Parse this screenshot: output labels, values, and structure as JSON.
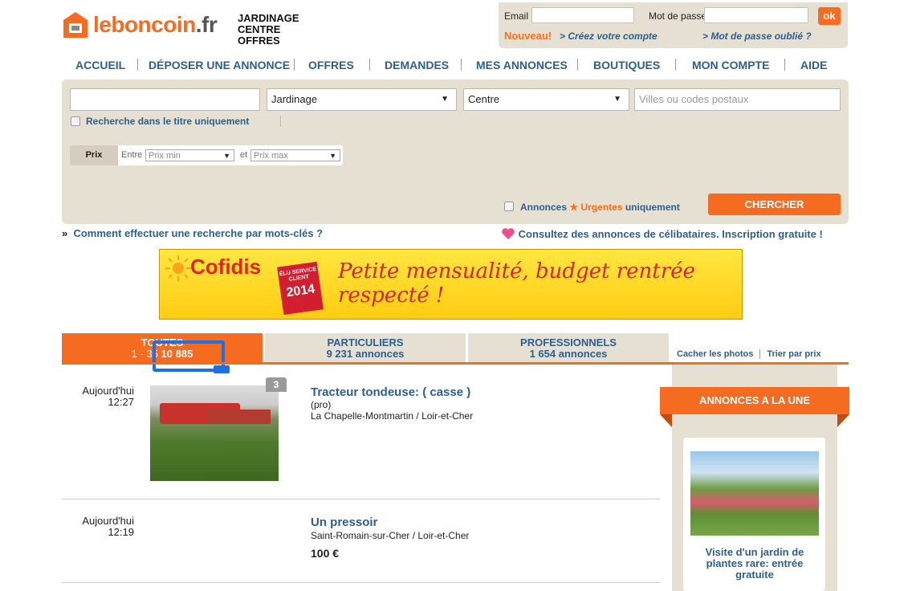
{
  "header": {
    "logo_text": "leboncoin",
    "logo_tld": ".fr",
    "crumbs": [
      "JARDINAGE",
      "CENTRE",
      "OFFRES"
    ]
  },
  "login": {
    "email_label": "Email",
    "password_label": "Mot de passe",
    "ok_label": "ok",
    "nouveau": "Nouveau!",
    "create_account": "> Créez votre compte",
    "forgot_password": "> Mot de passe oublié ?"
  },
  "nav": [
    "ACCUEIL",
    "DÉPOSER UNE ANNONCE",
    "OFFRES",
    "DEMANDES",
    "MES ANNONCES",
    "BOUTIQUES",
    "MON COMPTE",
    "AIDE"
  ],
  "search": {
    "keyword_value": "",
    "category": "Jardinage",
    "region": "Centre",
    "location_placeholder": "Villes ou codes postaux",
    "title_only_label": "Recherche dans le titre uniquement",
    "price_label": "Prix",
    "entre": "Entre",
    "et": "et",
    "price_min": "Prix min",
    "price_max": "Prix max",
    "urgent_1": "Annonces",
    "urgent_star": "★",
    "urgent_2": "Urgentes",
    "urgent_3": "uniquement",
    "submit": "CHERCHER"
  },
  "help": {
    "chevron": "»",
    "text": "Comment effectuer une recherche par mots-clés ?",
    "celib": "Consultez des annonces de célibataires. Inscription gratuite !"
  },
  "banner": {
    "brand": "Cofidis",
    "badge_top": "ÉLU SERVICE CLIENT",
    "badge_year": "2014",
    "slogan": "Petite mensualité, budget rentrée respecté !"
  },
  "tabs": [
    {
      "title": "TOUTES",
      "sub_range": "1 - 35",
      "sub_count": "10 885"
    },
    {
      "title": "PARTICULIERS",
      "sub": "9 231 annonces"
    },
    {
      "title": "PROFESSIONNELS",
      "sub": "1 654 annonces"
    }
  ],
  "tools": {
    "hide_photos": "Cacher les photos",
    "sort_price": "Trier par prix"
  },
  "listings": [
    {
      "date": "Aujourd'hui",
      "time": "12:27",
      "title": "Tracteur tondeuse: ( casse )",
      "tag": "(pro)",
      "location": "La Chapelle-Montmartin / Loir-et-Cher",
      "photos": "3",
      "price": ""
    },
    {
      "date": "Aujourd'hui",
      "time": "12:19",
      "title": "Un pressoir",
      "tag": "",
      "location": "Saint-Romain-sur-Cher / Loir-et-Cher",
      "photos": "",
      "price": "100 €"
    }
  ],
  "sidebar": {
    "header": "ANNONCES A LA UNE",
    "card_title": "Visite d'un jardin de plantes rare: entrée gratuite"
  },
  "colors": {
    "brand_orange": "#f56b20",
    "link_blue": "#2c5f8e",
    "panel_beige": "#e6e0d3",
    "highlight_blue": "#1f6fe0"
  }
}
